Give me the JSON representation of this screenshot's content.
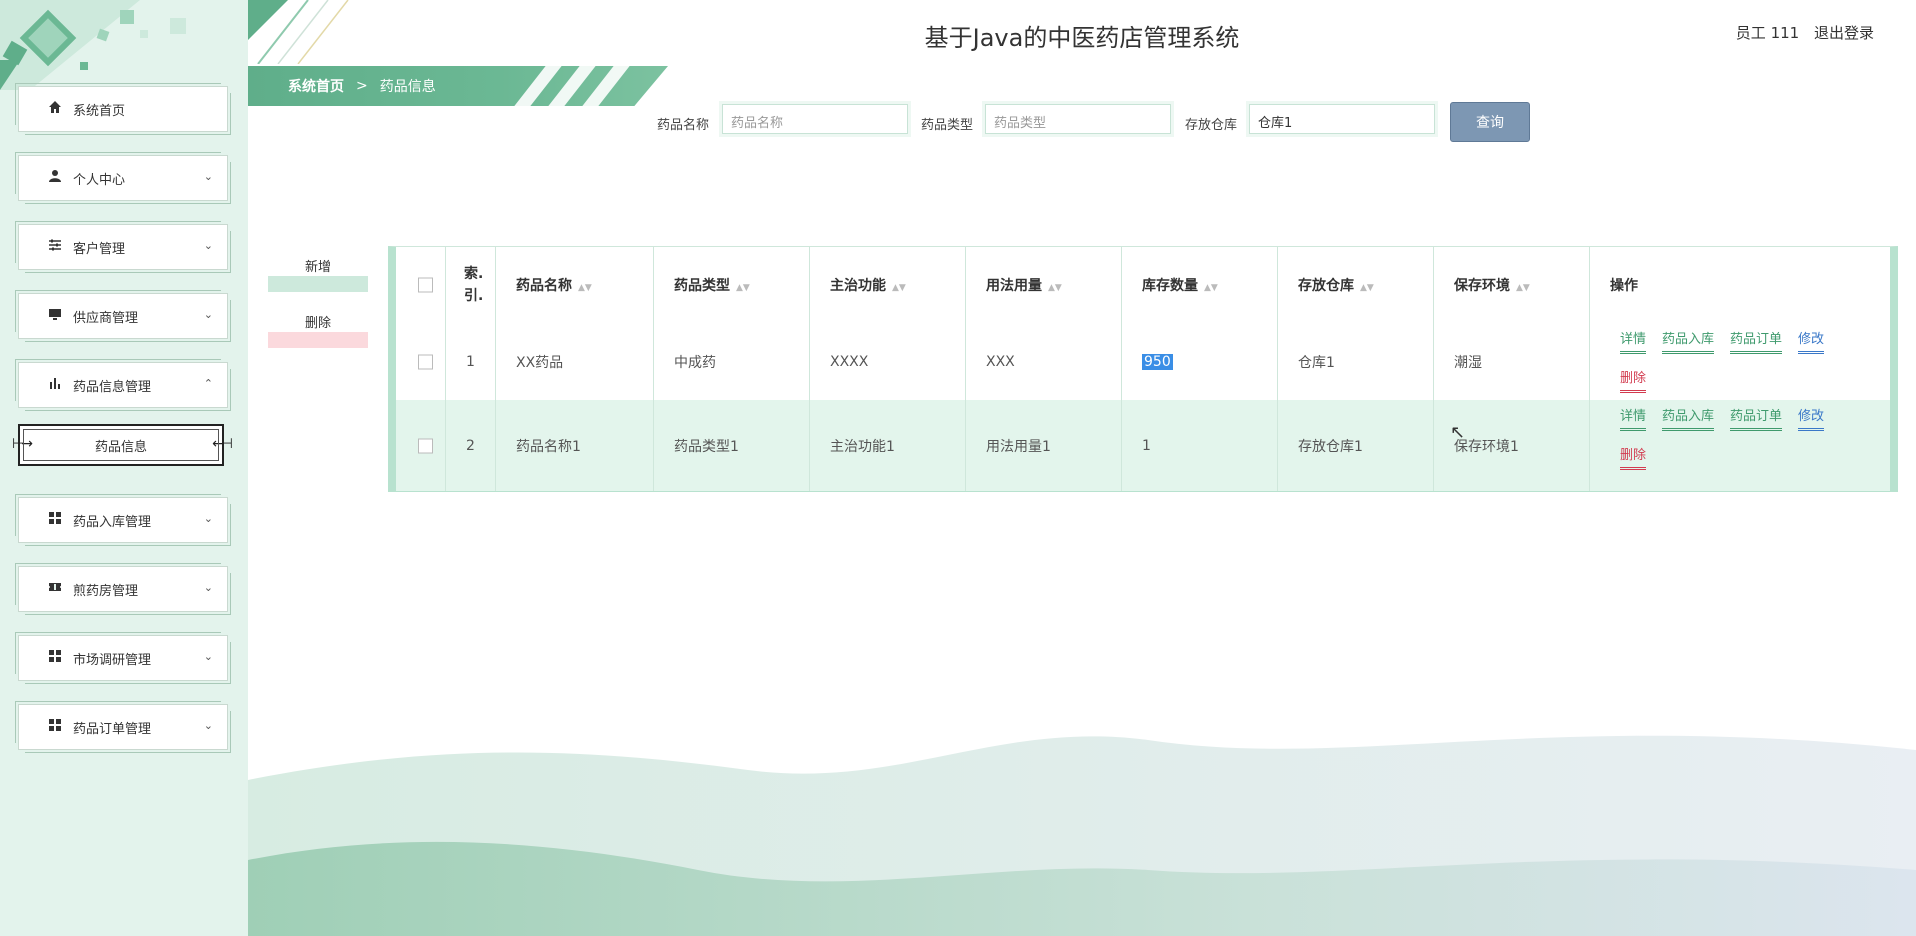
{
  "header": {
    "title": "基于Java的中医药店管理系统",
    "user": "员工 111",
    "logout": "退出登录"
  },
  "breadcrumb": {
    "home": "系统首页",
    "separator": ">",
    "current": "药品信息"
  },
  "sidebar": {
    "items": [
      {
        "label": "系统首页",
        "icon": "home-icon",
        "chevron": false
      },
      {
        "label": "个人中心",
        "icon": "user-icon",
        "chevron": true
      },
      {
        "label": "客户管理",
        "icon": "sliders-icon",
        "chevron": true
      },
      {
        "label": "供应商管理",
        "icon": "monitor-icon",
        "chevron": true
      },
      {
        "label": "药品信息管理",
        "icon": "chart-icon",
        "chevron": true,
        "expanded": true
      },
      {
        "label": "药品入库管理",
        "icon": "grid-icon",
        "chevron": true
      },
      {
        "label": "煎药房管理",
        "icon": "ticket-icon",
        "chevron": true
      },
      {
        "label": "市场调研管理",
        "icon": "grid-icon",
        "chevron": true
      },
      {
        "label": "药品订单管理",
        "icon": "grid-icon",
        "chevron": true
      }
    ],
    "sub_item": "药品信息"
  },
  "search": {
    "name_label": "药品名称",
    "name_placeholder": "药品名称",
    "name_value": "",
    "type_label": "药品类型",
    "type_placeholder": "药品类型",
    "type_value": "",
    "warehouse_label": "存放仓库",
    "warehouse_value": "仓库1",
    "button": "查询"
  },
  "actions": {
    "add": "新增",
    "delete": "删除"
  },
  "table": {
    "headers": [
      "索.\n引.",
      "药品名称",
      "药品类型",
      "主治功能",
      "用法用量",
      "库存数量",
      "存放仓库",
      "保存环境",
      "操作"
    ],
    "rows": [
      {
        "index": "1",
        "name": "XX药品",
        "type": "中成药",
        "function": "XXXX",
        "usage": "XXX",
        "stock": "950",
        "warehouse": "仓库1",
        "env": "潮湿"
      },
      {
        "index": "2",
        "name": "药品名称1",
        "type": "药品类型1",
        "function": "主治功能1",
        "usage": "用法用量1",
        "stock": "1",
        "warehouse": "存放仓库1",
        "env": "保存环境1"
      }
    ],
    "ops": {
      "detail": "详情",
      "stock_in": "药品入库",
      "order": "药品订单",
      "edit": "修改",
      "delete": "删除"
    }
  },
  "colors": {
    "accent": "#5fae8a",
    "sidebar_bg": "#e3f3ec",
    "query_button": "#7d97b3",
    "delete_link": "#d23b4f",
    "edit_link": "#3a78c8"
  }
}
